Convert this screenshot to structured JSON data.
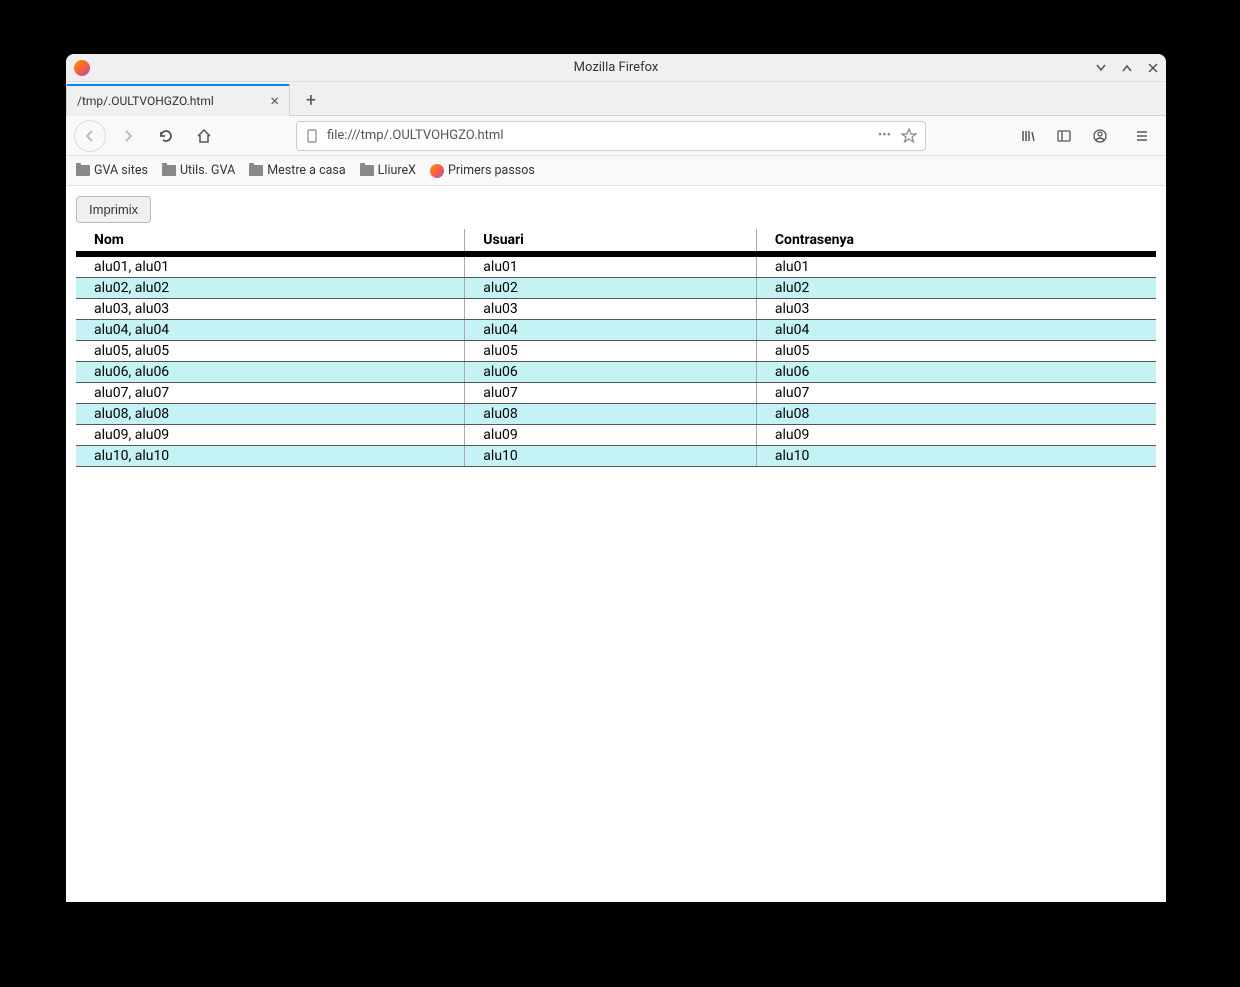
{
  "window": {
    "title": "Mozilla Firefox"
  },
  "tab": {
    "title": "/tmp/.OULTVOHGZO.html"
  },
  "urlbar": {
    "text": "file:///tmp/.OULTVOHGZO.html"
  },
  "bookmarks": [
    {
      "label": "GVA sites",
      "type": "folder"
    },
    {
      "label": "Utils. GVA",
      "type": "folder"
    },
    {
      "label": "Mestre a casa",
      "type": "folder"
    },
    {
      "label": "LliureX",
      "type": "folder"
    },
    {
      "label": "Primers passos",
      "type": "ff"
    }
  ],
  "page": {
    "print_button": "Imprimix",
    "headers": {
      "nom": "Nom",
      "usuari": "Usuari",
      "contrasenya": "Contrasenya"
    },
    "rows": [
      {
        "nom": "alu01, alu01",
        "usuari": "alu01",
        "contrasenya": "alu01"
      },
      {
        "nom": "alu02, alu02",
        "usuari": "alu02",
        "contrasenya": "alu02"
      },
      {
        "nom": "alu03, alu03",
        "usuari": "alu03",
        "contrasenya": "alu03"
      },
      {
        "nom": "alu04, alu04",
        "usuari": "alu04",
        "contrasenya": "alu04"
      },
      {
        "nom": "alu05, alu05",
        "usuari": "alu05",
        "contrasenya": "alu05"
      },
      {
        "nom": "alu06, alu06",
        "usuari": "alu06",
        "contrasenya": "alu06"
      },
      {
        "nom": "alu07, alu07",
        "usuari": "alu07",
        "contrasenya": "alu07"
      },
      {
        "nom": "alu08, alu08",
        "usuari": "alu08",
        "contrasenya": "alu08"
      },
      {
        "nom": "alu09, alu09",
        "usuari": "alu09",
        "contrasenya": "alu09"
      },
      {
        "nom": "alu10, alu10",
        "usuari": "alu10",
        "contrasenya": "alu10"
      }
    ]
  }
}
